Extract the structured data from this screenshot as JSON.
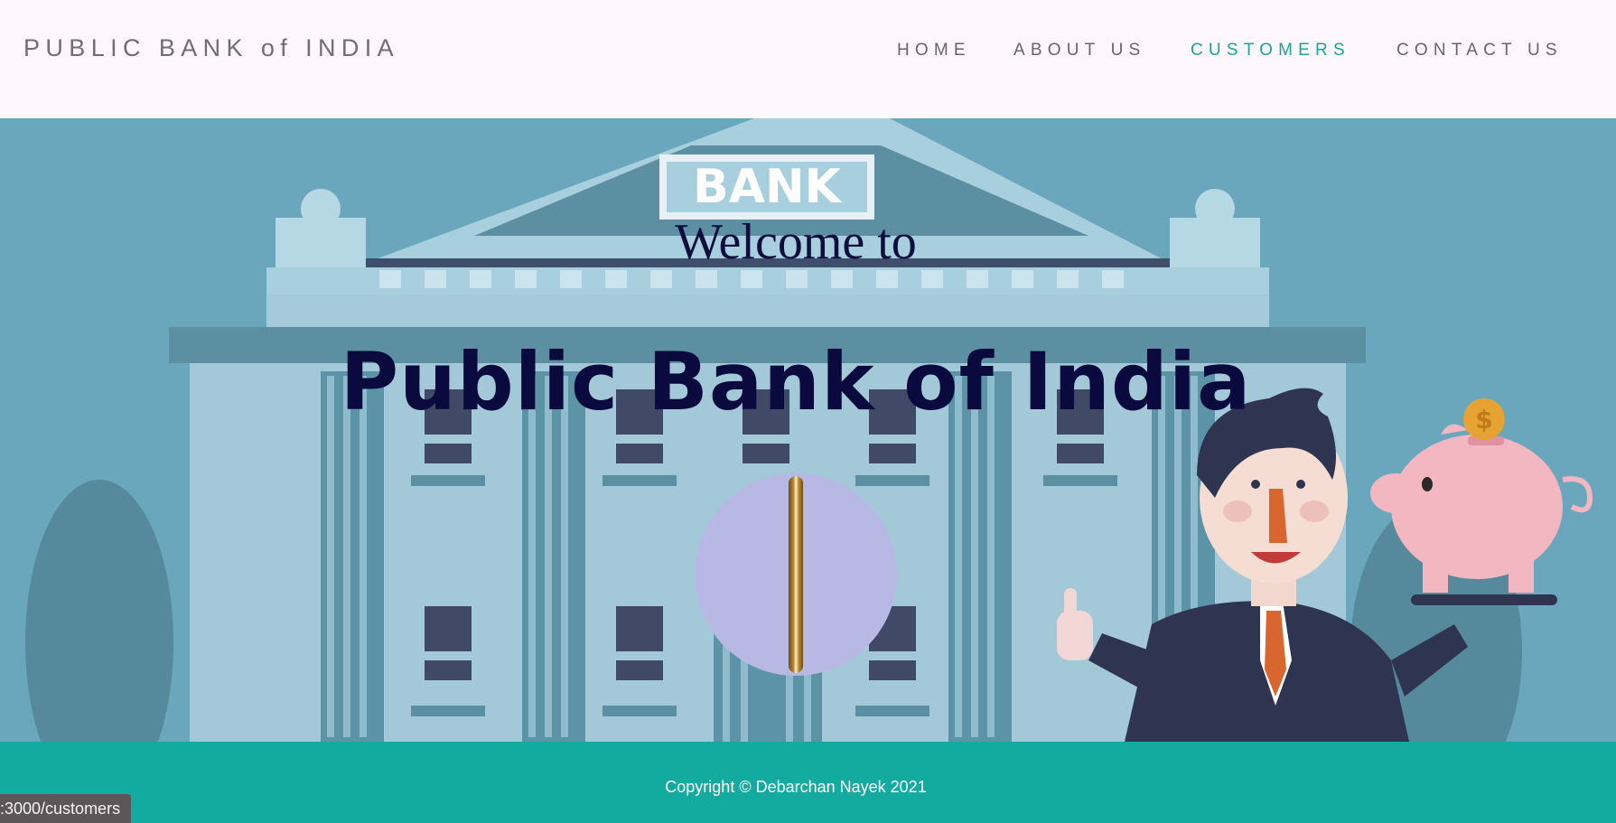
{
  "navbar": {
    "brand": "PUBLIC BANK of INDIA",
    "links": [
      {
        "label": "HOME",
        "active": false
      },
      {
        "label": "ABOUT US",
        "active": false
      },
      {
        "label": "CUSTOMERS",
        "active": true
      },
      {
        "label": "CONTACT US",
        "active": false
      }
    ]
  },
  "hero": {
    "bank_sign": "BANK",
    "welcome": "Welcome to",
    "title": "Public Bank of India",
    "coin_symbol": "$"
  },
  "footer": {
    "copyright": "Copyright © Debarchan Nayek 2021"
  },
  "status_bar": {
    "url": ":3000/customers"
  },
  "colors": {
    "accent": "#13aba0",
    "active_link": "#19a49c",
    "hero_text": "#0b0a3e",
    "navbar_bg": "#fef7fd"
  }
}
